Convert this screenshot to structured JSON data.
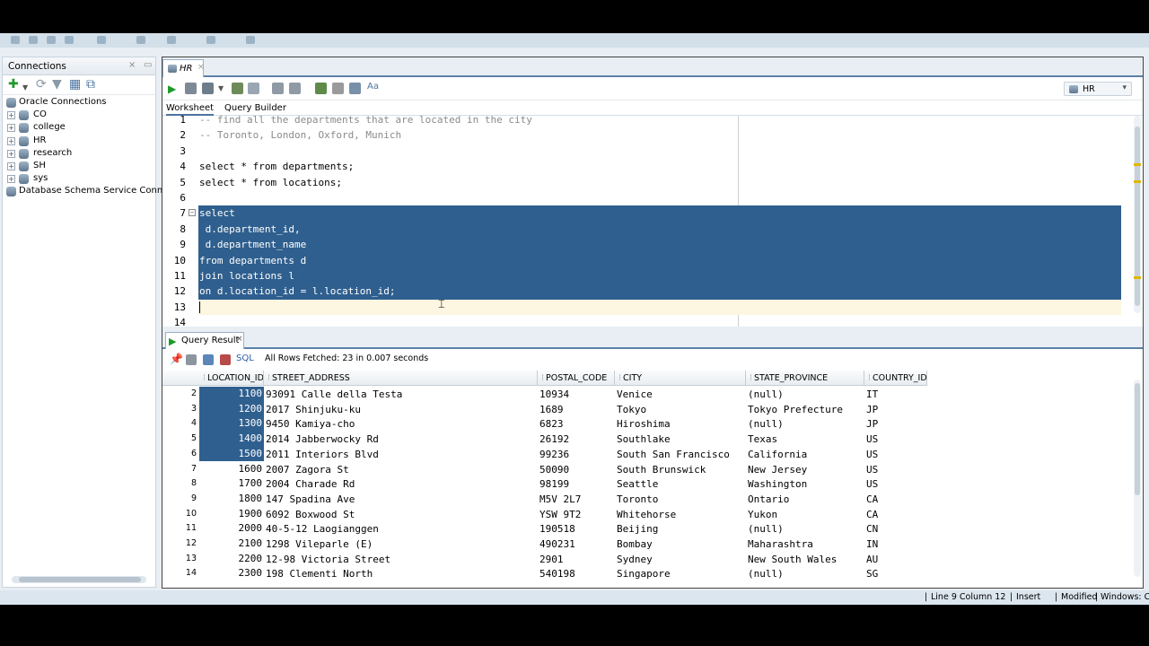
{
  "connections_panel": {
    "title": "Connections",
    "tree": [
      {
        "label": "Oracle Connections",
        "expandable": false
      },
      {
        "label": "CO",
        "expandable": true
      },
      {
        "label": "college",
        "expandable": true
      },
      {
        "label": "HR",
        "expandable": true
      },
      {
        "label": "research",
        "expandable": true
      },
      {
        "label": "SH",
        "expandable": true
      },
      {
        "label": "sys",
        "expandable": true
      },
      {
        "label": "Database Schema Service Connections",
        "expandable": false
      }
    ]
  },
  "editor": {
    "tab_label": "HR",
    "connection_selector": "HR",
    "subtabs": [
      "Worksheet",
      "Query Builder"
    ],
    "active_subtab": "Worksheet",
    "lines": [
      {
        "n": "1",
        "text": "-- find all the departments that are located in the city",
        "type": "comment"
      },
      {
        "n": "2",
        "text": "-- Toronto, London, Oxford, Munich",
        "type": "comment"
      },
      {
        "n": "3",
        "text": "",
        "type": "normal"
      },
      {
        "n": "4",
        "text": "select * from departments;",
        "type": "normal"
      },
      {
        "n": "5",
        "text": "select * from locations;",
        "type": "normal"
      },
      {
        "n": "6",
        "text": "",
        "type": "normal"
      },
      {
        "n": "7",
        "text": "select",
        "type": "selected"
      },
      {
        "n": "8",
        "text": " d.department_id,",
        "type": "selected"
      },
      {
        "n": "9",
        "text": " d.department_name",
        "type": "selected"
      },
      {
        "n": "10",
        "text": "from departments d",
        "type": "selected"
      },
      {
        "n": "11",
        "text": "join locations l",
        "type": "selected"
      },
      {
        "n": "12",
        "text": "on d.location_id = l.location_id;",
        "type": "selected"
      },
      {
        "n": "13",
        "text": "",
        "type": "current"
      },
      {
        "n": "14",
        "text": "",
        "type": "normal"
      }
    ]
  },
  "results": {
    "tab_label": "Query Result",
    "sql_label": "SQL",
    "status": "All Rows Fetched: 23 in 0.007 seconds",
    "columns": [
      "LOCATION_ID",
      "STREET_ADDRESS",
      "POSTAL_CODE",
      "CITY",
      "STATE_PROVINCE",
      "COUNTRY_ID"
    ],
    "rows": [
      [
        "2",
        "1100",
        "93091 Calle della Testa",
        "10934",
        "Venice",
        "(null)",
        "IT"
      ],
      [
        "3",
        "1200",
        "2017 Shinjuku-ku",
        "1689",
        "Tokyo",
        "Tokyo Prefecture",
        "JP"
      ],
      [
        "4",
        "1300",
        "9450 Kamiya-cho",
        "6823",
        "Hiroshima",
        "(null)",
        "JP"
      ],
      [
        "5",
        "1400",
        "2014 Jabberwocky Rd",
        "26192",
        "Southlake",
        "Texas",
        "US"
      ],
      [
        "6",
        "1500",
        "2011 Interiors Blvd",
        "99236",
        "South San Francisco",
        "California",
        "US"
      ],
      [
        "7",
        "1600",
        "2007 Zagora St",
        "50090",
        "South Brunswick",
        "New Jersey",
        "US"
      ],
      [
        "8",
        "1700",
        "2004 Charade Rd",
        "98199",
        "Seattle",
        "Washington",
        "US"
      ],
      [
        "9",
        "1800",
        "147 Spadina Ave",
        "M5V 2L7",
        "Toronto",
        "Ontario",
        "CA"
      ],
      [
        "10",
        "1900",
        "6092 Boxwood St",
        "YSW 9T2",
        "Whitehorse",
        "Yukon",
        "CA"
      ],
      [
        "11",
        "2000",
        "40-5-12 Laogianggen",
        "190518",
        "Beijing",
        "(null)",
        "CN"
      ],
      [
        "12",
        "2100",
        "1298 Vileparle (E)",
        "490231",
        "Bombay",
        "Maharashtra",
        "IN"
      ],
      [
        "13",
        "2200",
        "12-98 Victoria Street",
        "2901",
        "Sydney",
        "New South Wales",
        "AU"
      ],
      [
        "14",
        "2300",
        "198 Clementi North",
        "540198",
        "Singapore",
        "(null)",
        "SG"
      ]
    ],
    "selected_row_count": 5
  },
  "statusbar": {
    "position": "Line 9 Column 12",
    "mode": "Insert",
    "state": "Modified",
    "eol": "Windows: CI"
  },
  "colors": {
    "selection": "#2f5f8e",
    "current_line": "#fdf6e0",
    "accent": "#5b82a8"
  }
}
